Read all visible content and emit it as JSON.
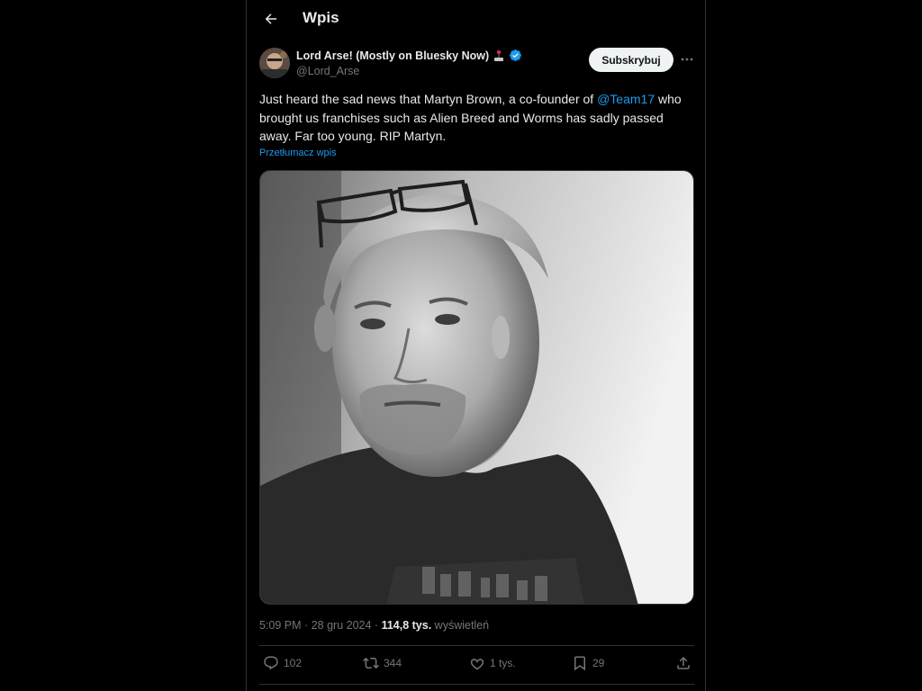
{
  "header": {
    "title": "Wpis"
  },
  "author": {
    "name": "Lord Arse! (Mostly on Bluesky Now)",
    "handle": "@Lord_Arse",
    "verified": true,
    "badge_icon": "joystick-icon"
  },
  "subscribe_label": "Subskrybuj",
  "tweet": {
    "text_before": "Just heard the sad news that Martyn Brown, a co-founder of ",
    "mention": "@Team17",
    "text_after": " who brought us franchises such as Alien Breed and Worms has sadly passed away. Far too young. RIP Martyn.",
    "translate_label": "Przetłumacz wpis"
  },
  "meta": {
    "time": "5:09 PM",
    "separator": "·",
    "date": "28 gru 2024",
    "views_count": "114,8 tys.",
    "views_label": "wyświetleń"
  },
  "actions": {
    "replies": "102",
    "reposts": "344",
    "likes": "1 tys.",
    "bookmarks": "29"
  },
  "colors": {
    "background": "#000000",
    "text": "#e7e9ea",
    "muted": "#71767b",
    "accent": "#1d9bf0",
    "border": "#2f3336"
  }
}
